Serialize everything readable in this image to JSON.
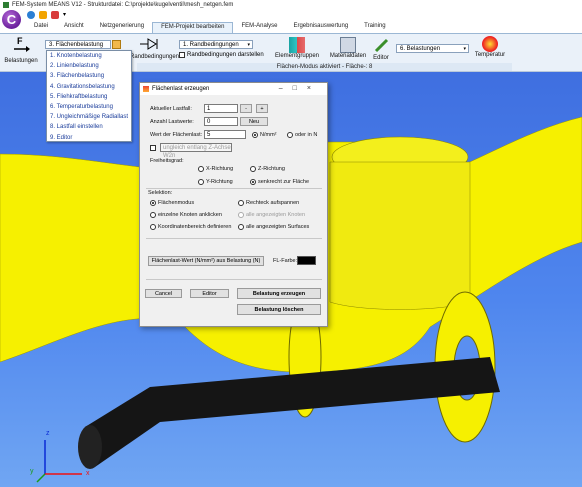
{
  "window": {
    "title": "FEM-System MEANS V12 - Strukturdatei: C:\\projekte\\kugelventil\\mesh_netgen.fem"
  },
  "app": {
    "logo_letter": "C"
  },
  "tabs": [
    {
      "label": "Datei"
    },
    {
      "label": "Ansicht"
    },
    {
      "label": "Netzgenerierung"
    },
    {
      "label": "FEM-Projekt bearbeiten"
    },
    {
      "label": "FEM-Analyse"
    },
    {
      "label": "Ergebnisauswertung"
    },
    {
      "label": "Training"
    }
  ],
  "ribbon": {
    "loads_label": "Belastungen",
    "load_type_combo": "3.  Flächenbelastung",
    "boundary_label": "Randbedingungen",
    "boundary_combo": "1.  Randbedingungen",
    "boundary_show_label": "Randbedingungen darstellen",
    "element_groups_label": "Elementgruppen",
    "material_label": "Materialdaten",
    "editor_label": "Editor",
    "loadcase_combo": "6.  Belastungen",
    "temperature_label": "Temperatur",
    "mode_status": "Flächen-Modus aktiviert - Fläche-: 8"
  },
  "load_types": [
    "1.  Knotenbelastung",
    "2.  Linienbelastung",
    "3.  Flächenbelastung",
    "4.  Gravitationsbelastung",
    "5.  Fliehkraftbelastung",
    "6.  Temperaturbelastung",
    "7.  Ungleichmäßige Radiallast",
    "8.  Lastfall einstellen",
    "9.  Editor"
  ],
  "dialog": {
    "title": "Flächenlast erzeugen",
    "current_loadcase_label": "Aktueller Lastfall:",
    "current_loadcase_value": "1",
    "minus": "-",
    "plus": "+",
    "loadcase_count_label": "Anzahl Lastwerte:",
    "loadcase_count_value": "0",
    "new_button": "Neu",
    "surface_load_label": "Wert der Flächenlast:",
    "surface_load_value": "5",
    "unit_nmm2": "N/mm²",
    "unit_n": "oder in N",
    "uneven_label": "ungleich entlang Z-Achse W2n",
    "dof_label": "Freiheitsgrad:",
    "dof_x": "X-Richtung",
    "dof_z": "Z-Richtung",
    "dof_y": "Y-Richtung",
    "dof_normal": "senkrecht zur Fläche",
    "selector_label": "Selektion:",
    "sel_surface_mode": "Flächenmodus",
    "sel_rect": "Rechteck aufspannen",
    "sel_single_nodes": "einzelne Knoten anklicken",
    "sel_all_nodes": "alle angezeigten Knoten",
    "sel_coord_range": "Koordinatenbereich definieren",
    "sel_all_surfaces": "alle angezeigten Surfaces",
    "load_from_button": "Flächenlast-Wert (N/mm²) aus Belastung (N)",
    "color_label": "FL-Farbe:",
    "color_value": "#000000",
    "cancel_button": "Cancel",
    "editor_button": "Editor",
    "create_button": "Belastung erzeugen",
    "delete_button": "Belastung löschen"
  },
  "axes": {
    "x": "x",
    "y": "y",
    "z": "z"
  },
  "colors": {
    "background_top": "#3f6fe0",
    "background_bottom": "#70a6f3",
    "part": "#f6f000",
    "shaft": "#151515"
  }
}
